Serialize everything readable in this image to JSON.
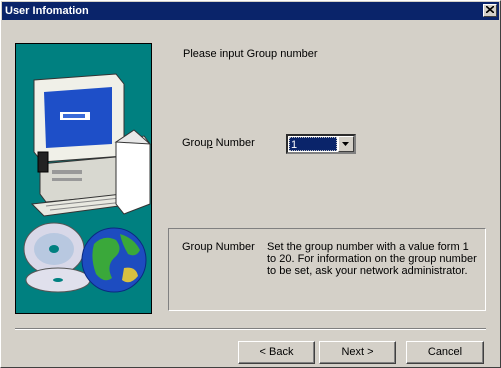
{
  "window": {
    "title": "User Infomation",
    "close_icon": "close-icon"
  },
  "main": {
    "prompt": "Please input Group number",
    "group_label": "Group Number",
    "group_value": "1"
  },
  "info": {
    "title": "Group Number",
    "text": "Set the group number with a value form 1 to 20. For information on the group number to be set, ask your network administrator."
  },
  "buttons": {
    "back": "< Back",
    "next": "Next >",
    "cancel": "Cancel"
  },
  "colors": {
    "titlebar": "#0a246a",
    "art_background": "#008080",
    "dialog_face": "#d4d0c8"
  }
}
